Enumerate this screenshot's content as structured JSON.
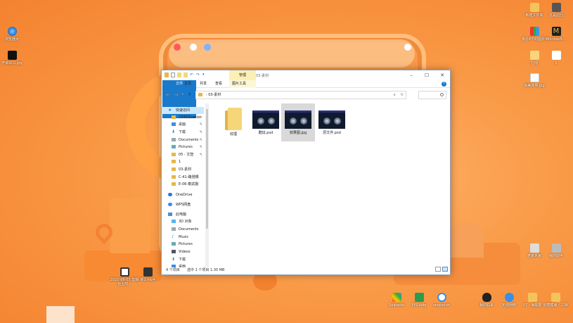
{
  "window": {
    "ribbon_context_tab": "管理",
    "title": "03-素材",
    "ribbon_tabs": [
      "文件",
      "主页",
      "共享",
      "查看",
      "图片工具"
    ],
    "help_icon": "?"
  },
  "address": {
    "path": "03-素材",
    "search_placeholder": ""
  },
  "sidebar": {
    "items": [
      {
        "label": "快速访问",
        "icon": "star-icon"
      },
      {
        "label": "2345Downlo",
        "icon": "folder-icon"
      },
      {
        "label": "桌面",
        "icon": "desktop-folder-icon"
      },
      {
        "label": "下载",
        "icon": "download-folder-icon"
      },
      {
        "label": "Documents",
        "icon": "documents-folder-icon"
      },
      {
        "label": "Pictures",
        "icon": "pictures-folder-icon"
      },
      {
        "label": "05 - 文智",
        "icon": "folder-icon"
      },
      {
        "label": "1",
        "icon": "folder-icon"
      },
      {
        "label": "03-素材",
        "icon": "folder-icon"
      },
      {
        "label": "C-41-路燈橋",
        "icon": "folder-icon"
      },
      {
        "label": "E-06-泰試摄",
        "icon": "folder-icon"
      },
      {
        "label": "OneDrive",
        "icon": "cloud-icon"
      },
      {
        "label": "WPS网盘",
        "icon": "cloud-icon"
      },
      {
        "label": "此电脑",
        "icon": "computer-icon"
      },
      {
        "label": "3D 对象",
        "icon": "3d-objects-icon"
      },
      {
        "label": "Documents",
        "icon": "documents-folder-icon"
      },
      {
        "label": "Music",
        "icon": "music-icon"
      },
      {
        "label": "Pictures",
        "icon": "pictures-folder-icon"
      },
      {
        "label": "Videos",
        "icon": "videos-icon"
      },
      {
        "label": "下载",
        "icon": "download-folder-icon"
      },
      {
        "label": "桌面",
        "icon": "desktop-folder-icon"
      }
    ]
  },
  "files": [
    {
      "name": "纹理",
      "kind": "folder"
    },
    {
      "name": "酷炫.psd",
      "kind": "image"
    },
    {
      "name": "效果图.jpg",
      "kind": "image",
      "selected": true
    },
    {
      "name": "原文件.psd",
      "kind": "image"
    }
  ],
  "status": {
    "count": "4 个项目",
    "selection": "选中 1 个项目  1.30 MB"
  },
  "desktop": {
    "left_icons": [
      {
        "label": "浏览器大"
      },
      {
        "label": "开启出口.jpg"
      }
    ],
    "right_icons": [
      {
        "label": "新建文件夹"
      },
      {
        "label": "这是此回"
      },
      {
        "label": "将近4个的图片5"
      },
      {
        "label": "Microsoft..."
      },
      {
        "label": "在线"
      },
      {
        "label": "1"
      },
      {
        "label": "完美效果.jpg"
      },
      {
        "label": "老家乡家"
      },
      {
        "label": "我的助手"
      }
    ],
    "bottom_left_icons": [
      {
        "label": "2021-06-03 剪辑台上的..."
      },
      {
        "label": "新2.mp4"
      }
    ],
    "bottom_right_icons": [
      {
        "label": "Snipaste"
      },
      {
        "label": "PPGuide"
      },
      {
        "label": "seojieyun"
      },
      {
        "label": "我的联系"
      },
      {
        "label": "无线网络"
      },
      {
        "label": "07 - 海报展"
      },
      {
        "label": "创意模版 - 三相"
      }
    ]
  },
  "colors": {
    "accent": "#1979ca",
    "context_tab": "#fbefb3",
    "selection": "#cce8ff",
    "wallpaper": "#f99a47"
  }
}
